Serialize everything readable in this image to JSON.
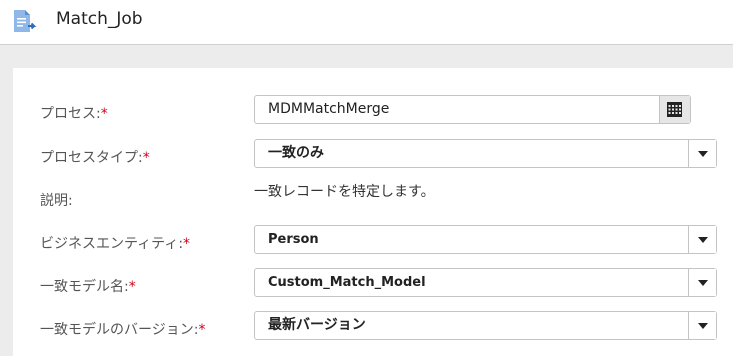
{
  "header": {
    "title": "Match_Job",
    "icon": "document-icon"
  },
  "colors": {
    "required": "#d0021b",
    "header_icon": "#4a90d9"
  },
  "form": {
    "process": {
      "label": "プロセス:",
      "required_mark": "*",
      "value": "MDMMatchMerge",
      "button_icon": "grid-picker-icon"
    },
    "process_type": {
      "label": "プロセスタイプ:",
      "required_mark": "*",
      "value": "一致のみ"
    },
    "description": {
      "label": "説明:",
      "value": "一致レコードを特定します。"
    },
    "business_entity": {
      "label": "ビジネスエンティティ:",
      "required_mark": "*",
      "value": "Person"
    },
    "match_model_name": {
      "label": "一致モデル名:",
      "required_mark": "*",
      "value": "Custom_Match_Model"
    },
    "match_model_version": {
      "label": "一致モデルのバージョン:",
      "required_mark": "*",
      "value": "最新バージョン"
    }
  }
}
